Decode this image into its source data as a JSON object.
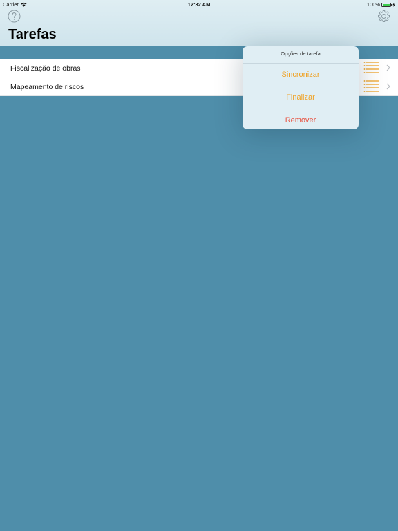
{
  "status_bar": {
    "carrier": "Carrier",
    "time": "12:32 AM",
    "battery": "100%",
    "battery_level": 1.0
  },
  "header": {
    "title": "Tarefas",
    "help_icon": "question-circle-icon",
    "settings_icon": "gear-icon"
  },
  "tasks": [
    {
      "label": "Fiscalização de obras"
    },
    {
      "label": "Mapeamento de riscos"
    }
  ],
  "popover": {
    "title": "Opções de tarefa",
    "actions": [
      {
        "label": "Sincronizar",
        "color": "#f0a020"
      },
      {
        "label": "Finalizar",
        "color": "#f0a020"
      },
      {
        "label": "Remover",
        "color": "#e8513f"
      }
    ]
  },
  "colors": {
    "background": "#4f8eaa",
    "accent": "#f0a020",
    "destructive": "#e8513f",
    "nav_bar": "#d8e9ef"
  }
}
